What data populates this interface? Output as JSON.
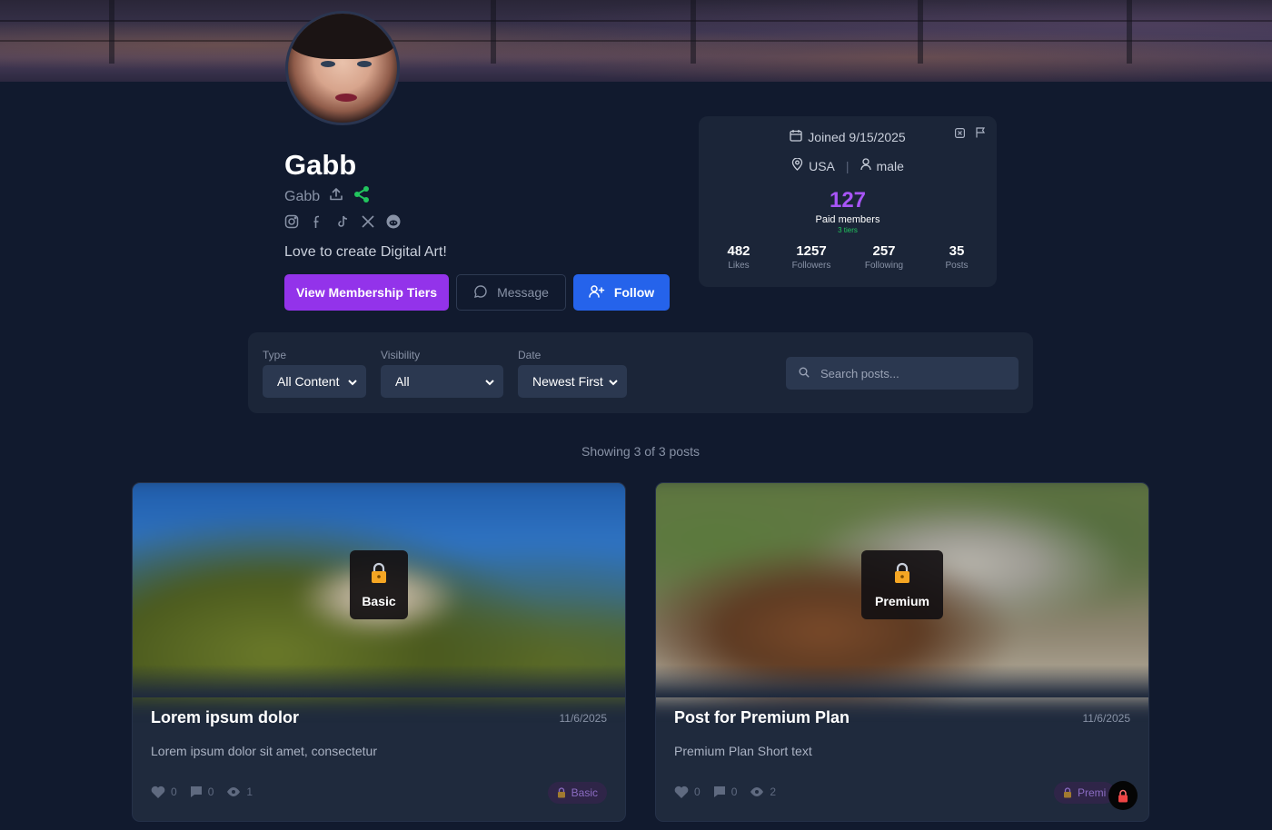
{
  "profile": {
    "name": "Gabb",
    "handle": "Gabb",
    "bio": "Love to create Digital Art!",
    "social_icons": [
      "instagram-icon",
      "facebook-icon",
      "tiktok-icon",
      "x-icon",
      "reddit-icon"
    ]
  },
  "actions": {
    "tiers_label": "View Membership Tiers",
    "message_label": "Message",
    "follow_label": "Follow"
  },
  "stats_card": {
    "joined": "Joined 9/15/2025",
    "country": "USA",
    "gender": "male",
    "paid_members": "127",
    "paid_members_label": "Paid members",
    "tiers_count_label": "3 tiers",
    "stats": [
      {
        "value": "482",
        "label": "Likes"
      },
      {
        "value": "1257",
        "label": "Followers"
      },
      {
        "value": "257",
        "label": "Following"
      },
      {
        "value": "35",
        "label": "Posts"
      }
    ]
  },
  "filters": {
    "type_label": "Type",
    "type_value": "All Content",
    "visibility_label": "Visibility",
    "visibility_value": "All",
    "date_label": "Date",
    "date_value": "Newest First",
    "search_placeholder": "Search posts..."
  },
  "showing_text": "Showing 3 of 3 posts",
  "posts": [
    {
      "title": "Lorem ipsum dolor",
      "date": "11/6/2025",
      "text": "Lorem ipsum dolor sit amet, consectetur",
      "lock_label": "Basic",
      "likes": "0",
      "comments": "0",
      "views": "1",
      "tier": "Basic"
    },
    {
      "title": "Post for Premium Plan",
      "date": "11/6/2025",
      "text": "Premium Plan Short text",
      "lock_label": "Premium",
      "likes": "0",
      "comments": "0",
      "views": "2",
      "tier": "Premi"
    }
  ],
  "colors": {
    "accent_purple": "#9333ea",
    "accent_blue": "#2563eb",
    "paid_count": "#a855f7",
    "tiers_green": "#22c55e",
    "share_green": "#22c55e"
  }
}
